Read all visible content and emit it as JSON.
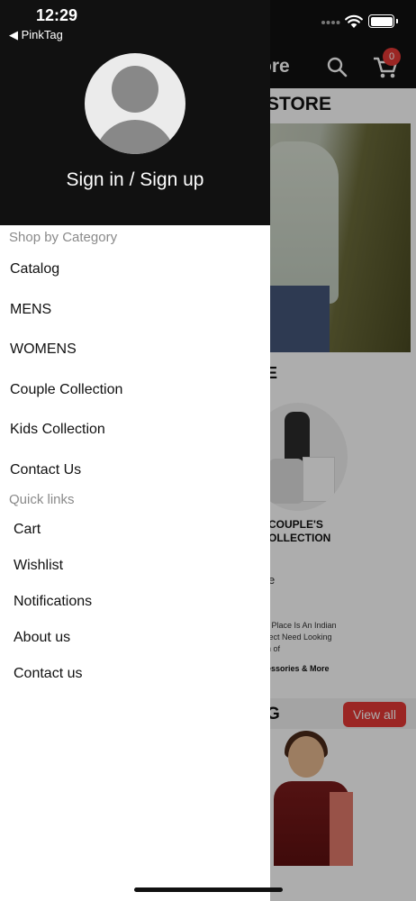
{
  "status_bar": {
    "time": "12:29",
    "back_app": "◀ PinkTag"
  },
  "drawer": {
    "sign_in_label": "Sign in / Sign up",
    "shop_by_category_label": "Shop by Category",
    "categories": [
      "Catalog",
      "MENS",
      "WOMENS",
      "Couple Collection",
      "Kids Collection",
      "Contact Us"
    ],
    "quick_links_label": "Quick links",
    "quick_links": [
      "Cart",
      "Wishlist",
      "Notifications",
      "About us",
      "Contact us"
    ]
  },
  "background_page": {
    "title_partial": "ore",
    "cart_count": "0",
    "store_heading_partial": "STORE",
    "section_partial": "E",
    "couple_collection_label_line1": "COUPLE'S",
    "couple_collection_label_line2": "OLLECTION",
    "partial_text": "e",
    "description_partial": "- Place Is An Indian fect Need Looking n of",
    "accessories_partial": "essories & More",
    "catalog_heading_partial": "G",
    "view_all_label": "View all"
  },
  "colors": {
    "header_bg": "#111111",
    "accent_red": "#e53935",
    "muted_label": "#8a8a8a"
  },
  "icons": [
    "search-icon",
    "cart-icon",
    "user-avatar-icon",
    "signal-icon",
    "wifi-icon",
    "battery-icon"
  ]
}
